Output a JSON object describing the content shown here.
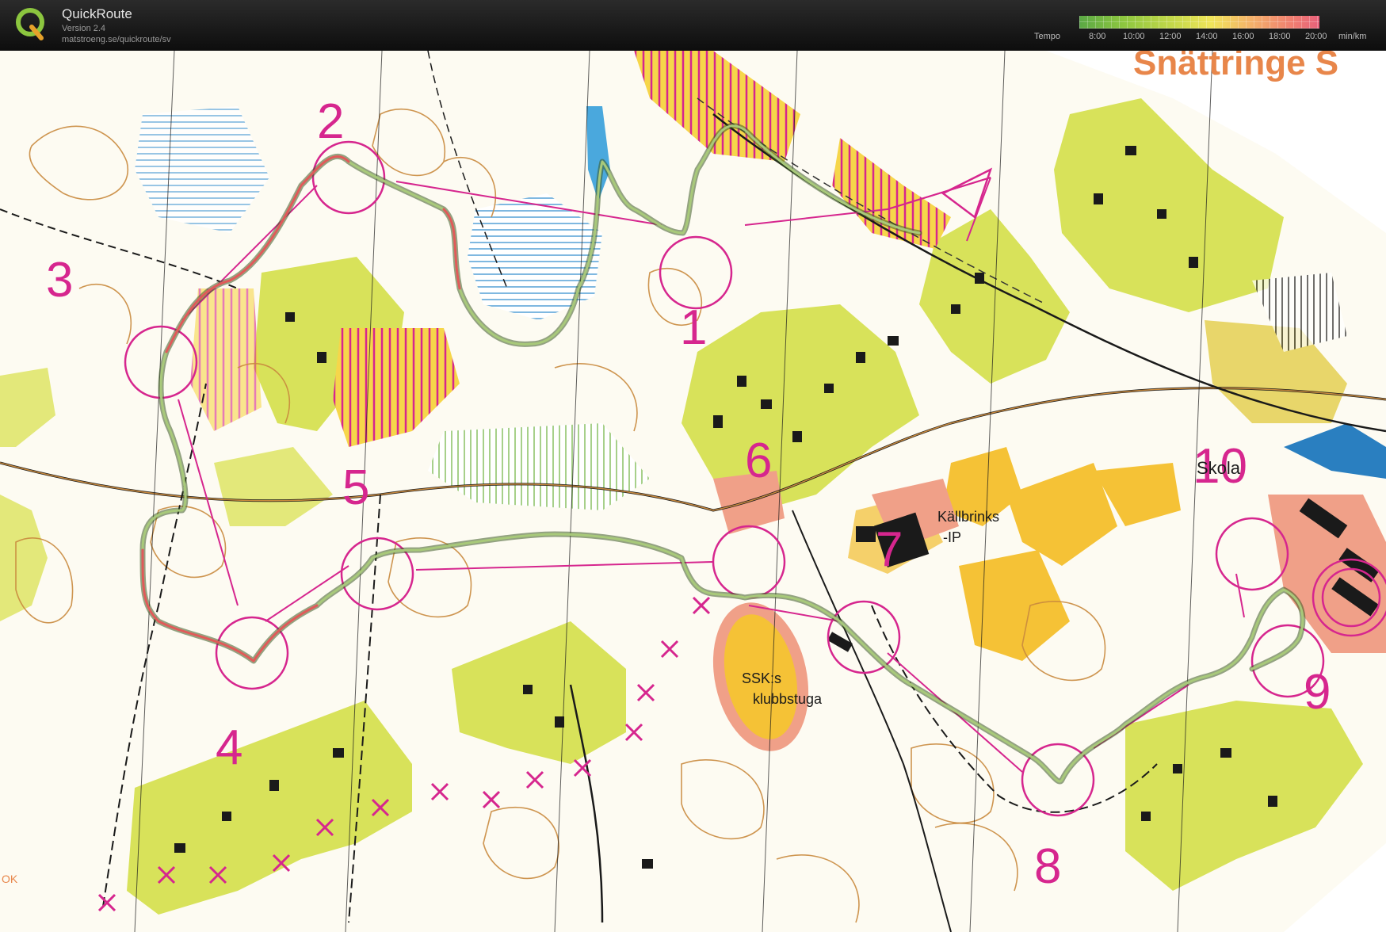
{
  "header": {
    "app_name": "QuickRoute",
    "version": "Version 2.4",
    "url": "matstroeng.se/quickroute/sv",
    "logo_letter": "Q",
    "tempo_label": "Tempo",
    "tempo_ticks": [
      "8:00",
      "10:00",
      "12:00",
      "14:00",
      "16:00",
      "18:00",
      "20:00"
    ],
    "tempo_unit": "min/km"
  },
  "map": {
    "title_text": "Snättringe S",
    "controls": [
      "1",
      "2",
      "3",
      "4",
      "5",
      "6",
      "7",
      "8",
      "9",
      "10"
    ],
    "labels": {
      "clubhouse_line1": "SSK:s",
      "clubhouse_line2": "klubbstuga",
      "sports_ground_line1": "Källbrinks",
      "sports_ground_line2": "-IP",
      "school": "Skola",
      "corner_ok": "OK"
    },
    "colors": {
      "course": "#d6268e",
      "route": "#5a7a3a",
      "open_land": "#f5e25a",
      "green_rough": "#d8e25a",
      "building": "#1a1a1a",
      "contour": "#c98a3e",
      "water": "#8ec9e8"
    }
  }
}
